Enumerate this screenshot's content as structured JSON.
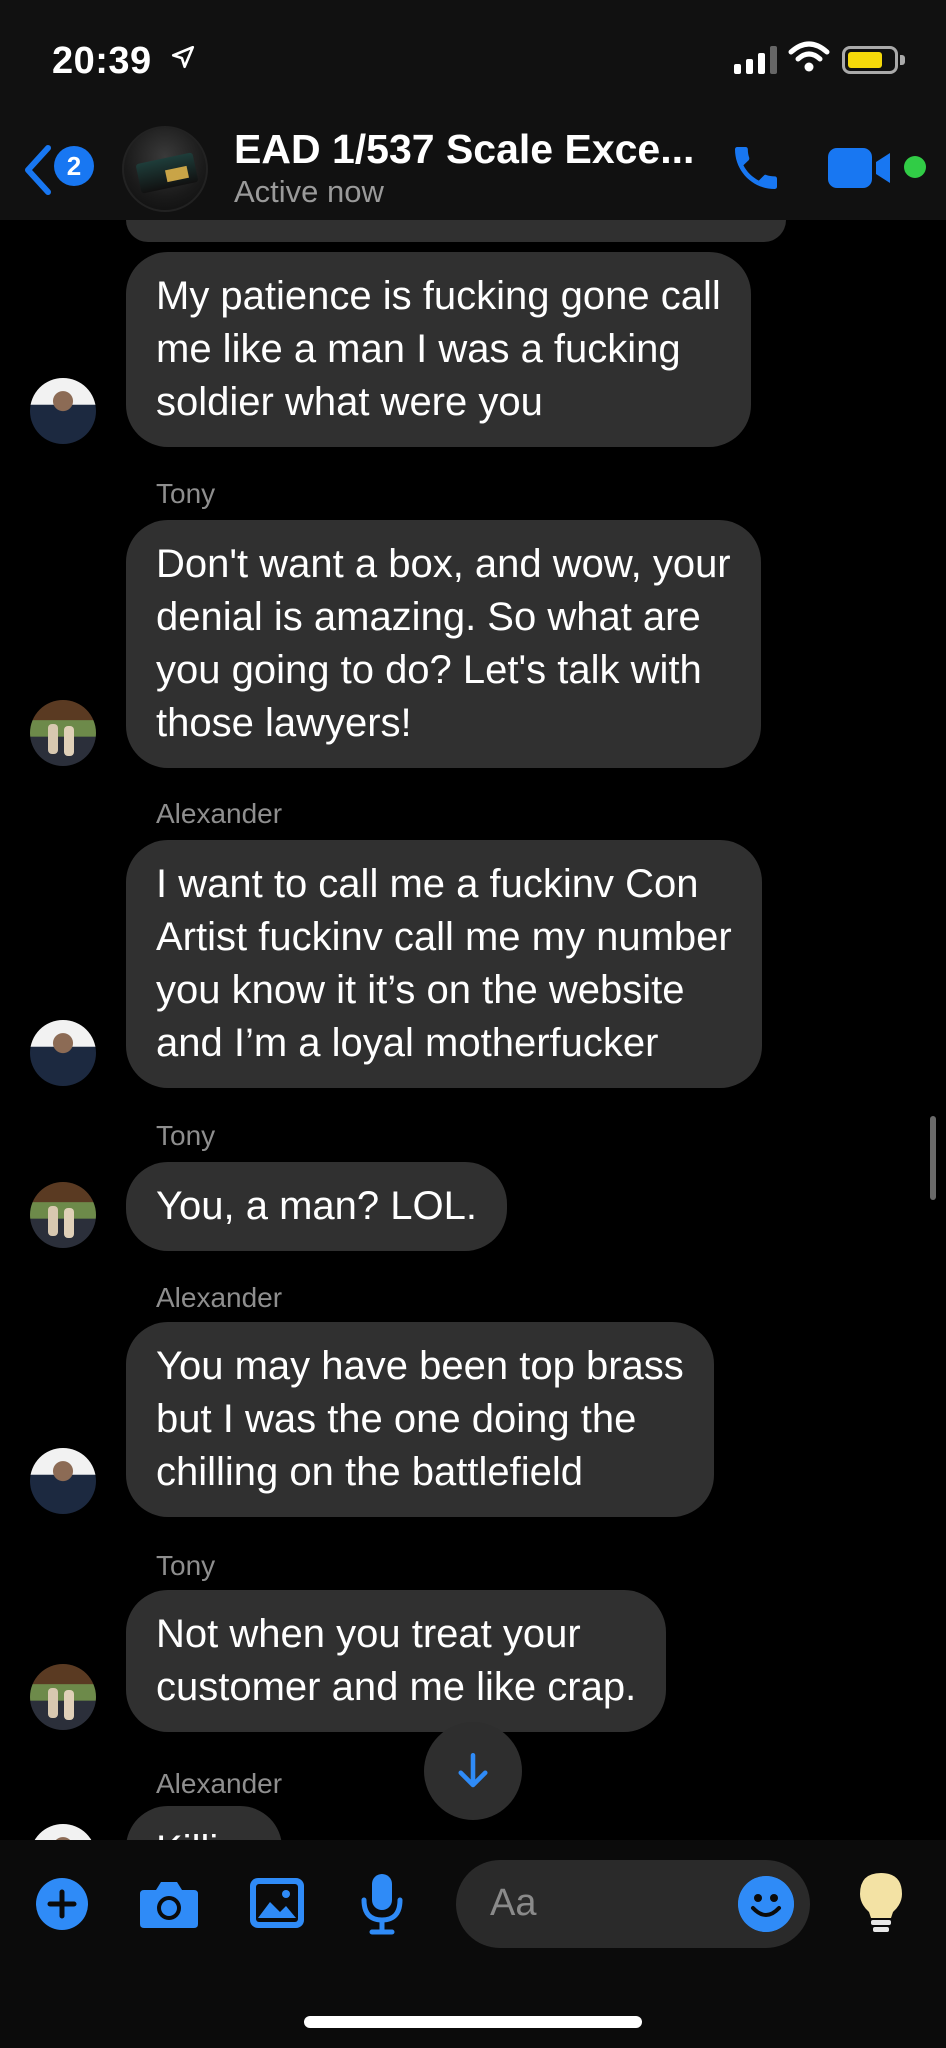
{
  "status_bar": {
    "time": "20:39"
  },
  "header": {
    "unread_count": "2",
    "title": "EAD 1/537  Scale Exce...",
    "status": "Active now"
  },
  "messages": [
    {
      "sender": "",
      "text_lines": [
        "My patience is fucking gone call",
        "me like a man I was a fucking",
        "soldier what were you"
      ]
    },
    {
      "sender": "Tony",
      "text_lines": [
        "Don't want a box, and wow, your",
        "denial is amazing.  So what are",
        "you going to do?  Let's talk with",
        "those lawyers!"
      ]
    },
    {
      "sender": "Alexander",
      "text_lines": [
        "I want to call me a fuckinv Con",
        "Artist fuckinv call me my number",
        "you know it it’s on the website",
        "and I’m a loyal motherfucker"
      ]
    },
    {
      "sender": "Tony",
      "text_lines": [
        "You, a man?  LOL."
      ]
    },
    {
      "sender": "Alexander",
      "text_lines": [
        "You may have been top brass",
        "but I was the one doing the",
        "chilling on the battlefield"
      ]
    },
    {
      "sender": "Tony",
      "text_lines": [
        "Not when you treat your",
        "customer and me like crap."
      ]
    },
    {
      "sender": "Alexander",
      "text_lines": [
        "Killi..."
      ]
    }
  ],
  "composer": {
    "placeholder": "Aa"
  },
  "colors": {
    "accent": "#1877f2",
    "bubble": "#303030",
    "online": "#31cc46",
    "battery": "#f5d90a"
  }
}
